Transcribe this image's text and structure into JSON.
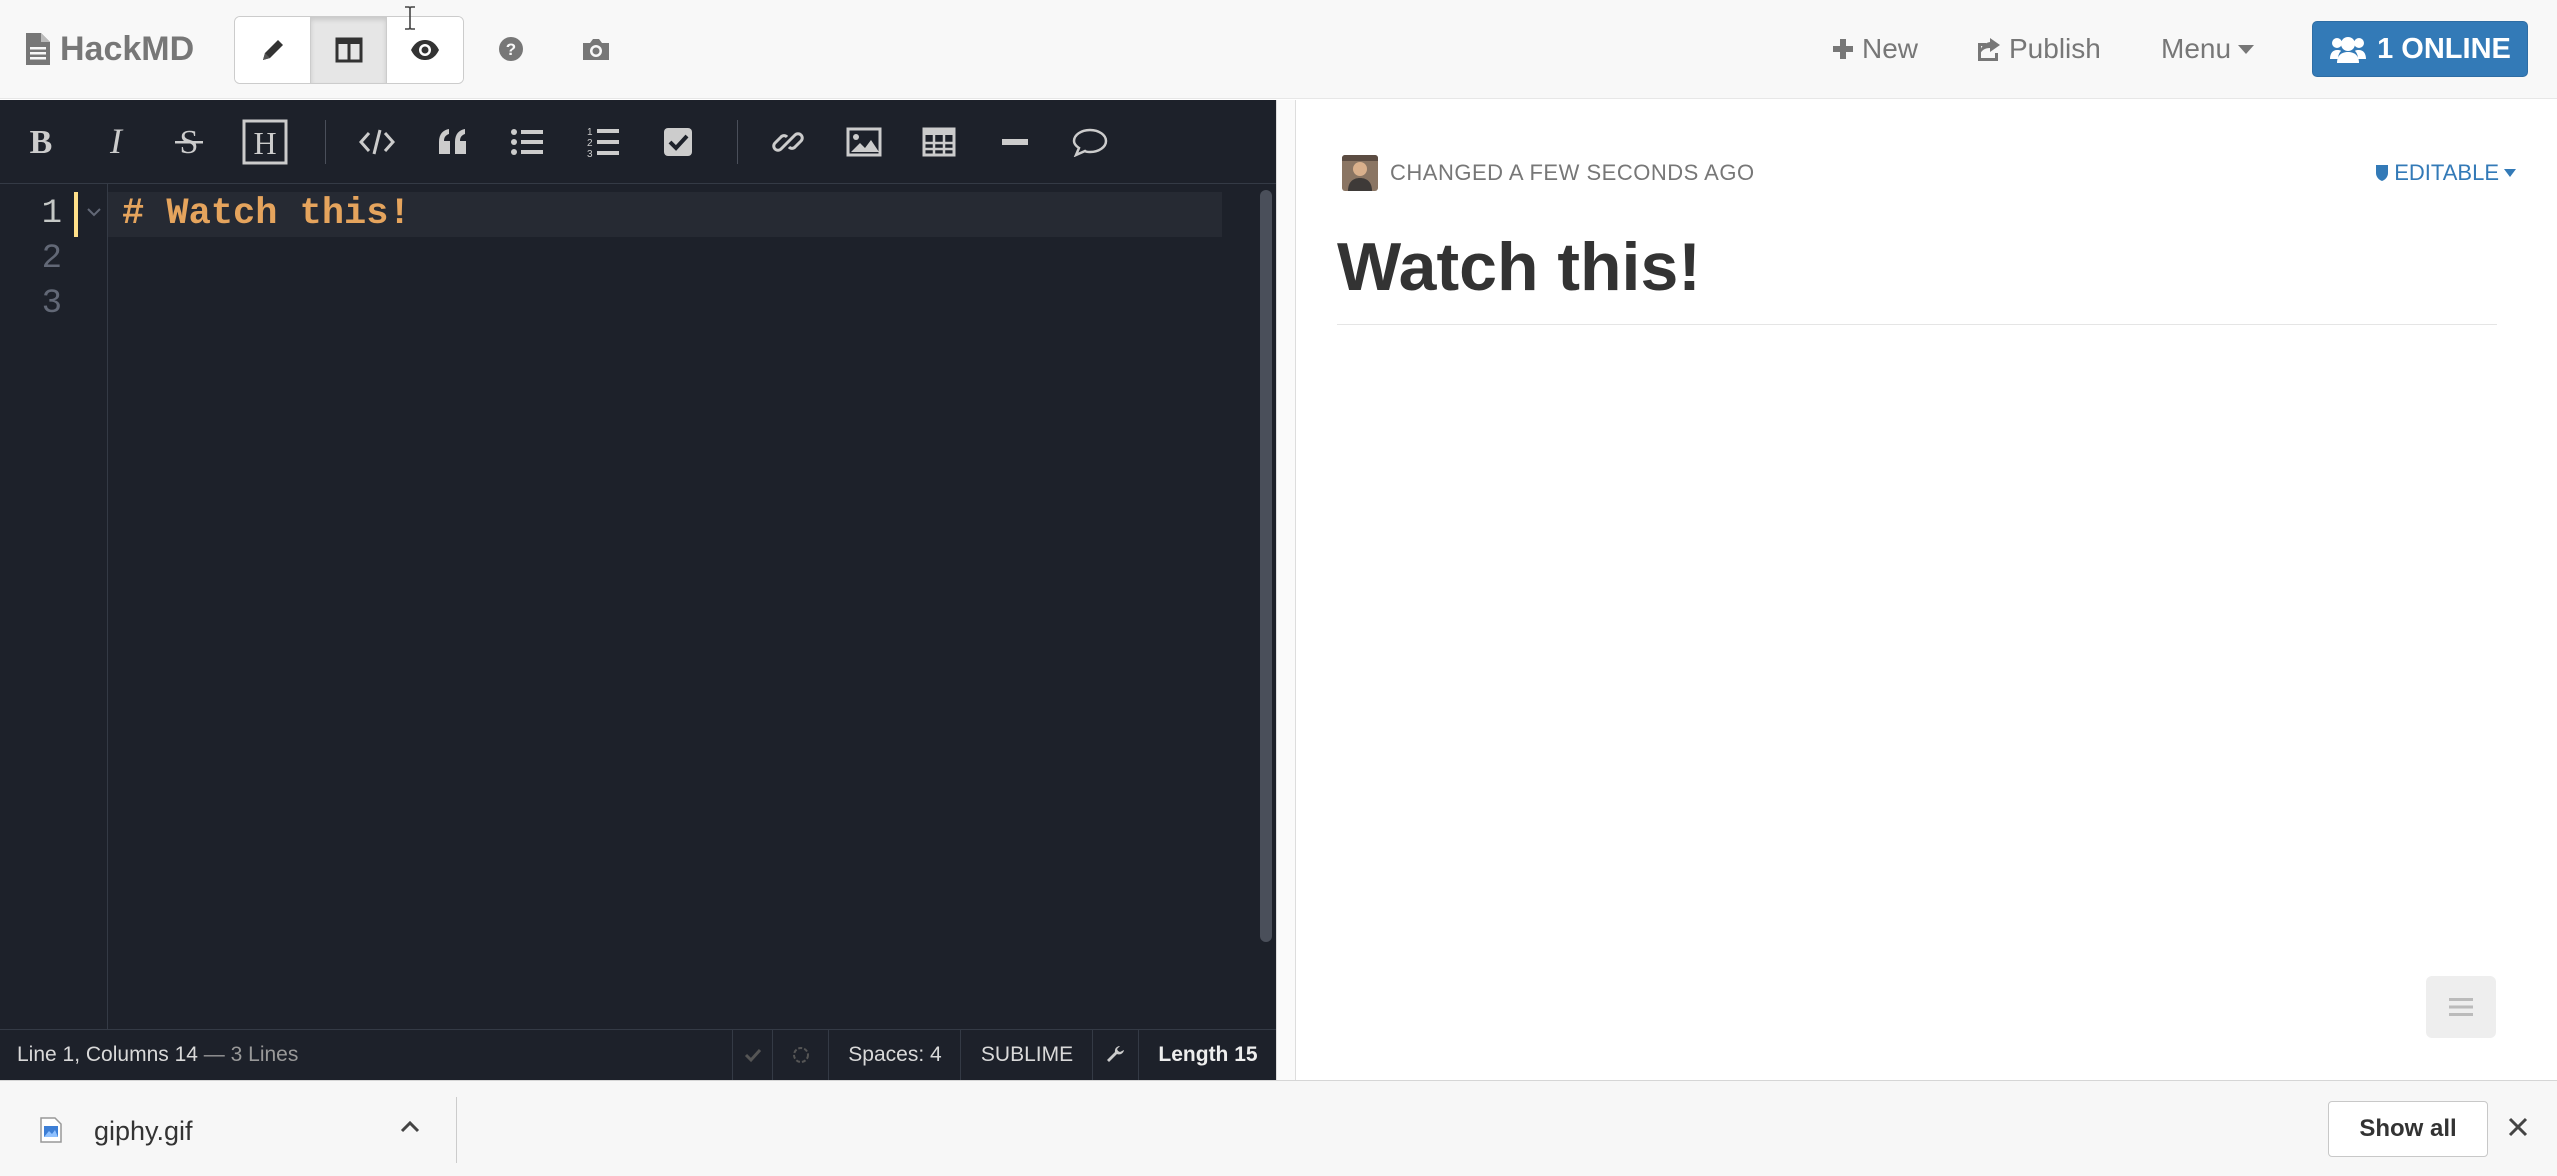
{
  "navbar": {
    "brand": "HackMD",
    "mode_buttons": [
      "edit-icon",
      "split-view-icon",
      "view-icon"
    ],
    "help_icon": "question-circle-icon",
    "snapshot_icon": "camera-icon",
    "new_label": "New",
    "publish_label": "Publish",
    "menu_label": "Menu",
    "online_label": "1 ONLINE"
  },
  "toolbar": {
    "buttons": [
      "bold",
      "italic",
      "strikethrough",
      "header",
      "code",
      "quote",
      "unordered-list",
      "ordered-list",
      "checkbox",
      "link",
      "image",
      "table",
      "horizontal-line",
      "comment"
    ]
  },
  "editor": {
    "line_numbers": [
      "1",
      "2",
      "3"
    ],
    "lines": [
      "# Watch this!",
      "",
      ""
    ],
    "status": {
      "position": "Line 1, Columns 14",
      "lines_count": " — 3 Lines",
      "spaces": "Spaces: 4",
      "keymap": "SUBLIME",
      "length": "Length 15"
    }
  },
  "preview": {
    "changed": "CHANGED A FEW SECONDS AGO",
    "editable": "EDITABLE",
    "heading": "Watch this!"
  },
  "downloads": {
    "file_name": "giphy.gif",
    "show_all": "Show all"
  },
  "colors": {
    "editor_bg": "#1d212a",
    "heading_code": "#e5a45d",
    "primary": "#337ab7"
  }
}
